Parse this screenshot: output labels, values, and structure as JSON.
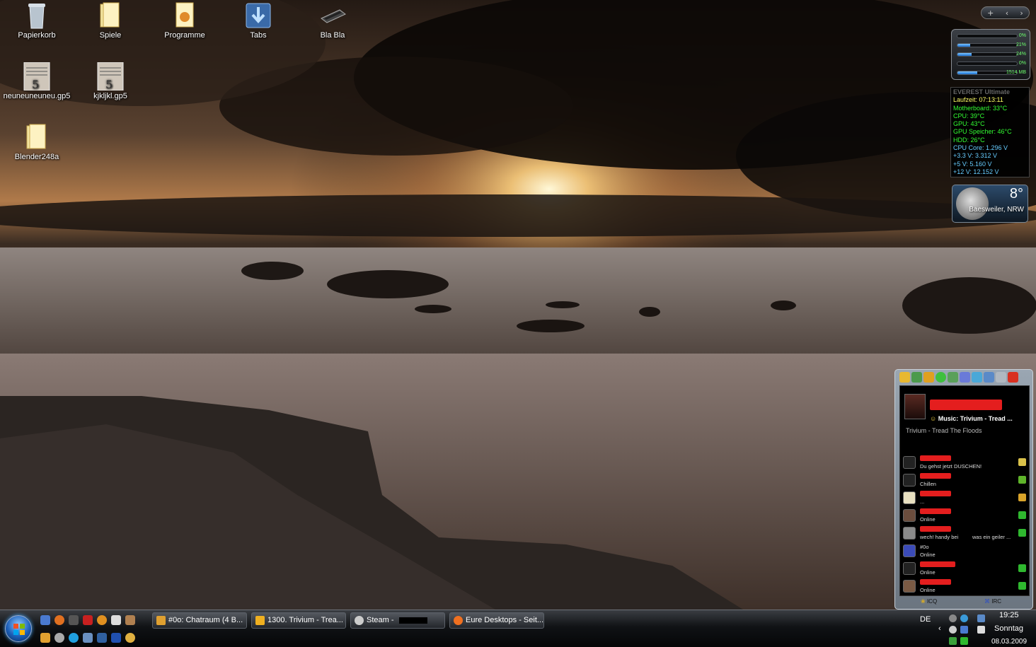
{
  "desktop": {
    "icons": [
      {
        "name": "papierkorb-icon",
        "label": "Papierkorb"
      },
      {
        "name": "spiele-folder-icon",
        "label": "Spiele"
      },
      {
        "name": "programme-folder-icon",
        "label": "Programme"
      },
      {
        "name": "tabs-icon",
        "label": "Tabs"
      },
      {
        "name": "blabla-icon",
        "label": "Bla Bla"
      },
      {
        "name": "neuneuneuneu-gp5-icon",
        "label": "neuneuneuneu.gp5"
      },
      {
        "name": "kjkljkl-gp5-icon",
        "label": "kjkljkl.gp5"
      },
      {
        "name": "blender248a-folder-icon",
        "label": "Blender248a"
      }
    ]
  },
  "gadgets": {
    "controls": {
      "add": "+"
    },
    "meter": {
      "rows": [
        {
          "label": "0%",
          "fraction": 0.0
        },
        {
          "label": "21%",
          "fraction": 0.21
        },
        {
          "label": "24%",
          "fraction": 0.24
        },
        {
          "label": "0%",
          "fraction": 0.0
        },
        {
          "label": "1514 MB",
          "fraction": 0.33
        }
      ]
    },
    "everest": {
      "title": "EVEREST Ultimate",
      "lines": [
        {
          "text": "Laufzeit: 07:13:11",
          "color": "#ffff66"
        },
        {
          "text": "Motherboard: 33°C",
          "color": "#33ff33"
        },
        {
          "text": "CPU: 39°C",
          "color": "#33ff33"
        },
        {
          "text": "GPU: 43°C",
          "color": "#33ff33"
        },
        {
          "text": "GPU Speicher: 46°C",
          "color": "#33ff33"
        },
        {
          "text": "HDD: 26°C",
          "color": "#33ff33"
        },
        {
          "text": "CPU Core: 1.296 V",
          "color": "#66ccff"
        },
        {
          "text": "+3.3 V: 3.312 V",
          "color": "#66ccff"
        },
        {
          "text": "+5 V: 5.160 V",
          "color": "#66ccff"
        },
        {
          "text": "+12 V: 12.152 V",
          "color": "#66ccff"
        }
      ]
    },
    "weather": {
      "temp": "8°",
      "location": "Baesweiler, NRW"
    }
  },
  "icq": {
    "status_message": "Music: Trivium - Tread ...",
    "song": "Trivium - Tread The Floods",
    "contacts": [
      {
        "status": "Du gehst jetzt DUSCHEN!",
        "extra": "",
        "avatar_color": "#222",
        "flag_color": "#d9c14a"
      },
      {
        "status": "Chillen",
        "extra": "",
        "avatar_color": "#222",
        "flag_color": "#5fb42a"
      },
      {
        "status": "...",
        "extra": "",
        "avatar_color": "#e8e0c0",
        "flag_color": "#d9a42a"
      },
      {
        "status": "Online",
        "extra": "",
        "avatar_color": "#6b4d3d",
        "flag_color": "#2fb82f"
      },
      {
        "status": "wech! handy bei",
        "extra": "was ein geiler ...",
        "avatar_color": "#8a8a8a",
        "flag_color": "#2fb82f"
      },
      {
        "status": "#0o",
        "sub": "Online",
        "extra": "",
        "avatar_color": "#3b4bb8",
        "flag_color": ""
      },
      {
        "status": "Online",
        "extra": "",
        "avatar_color": "#222",
        "flag_color": "#2fb82f"
      },
      {
        "status": "Online",
        "extra": "",
        "avatar_color": "#7a5a44",
        "flag_color": "#2fb82f"
      }
    ],
    "tabs": {
      "icq": "ICQ",
      "irc": "IRC"
    }
  },
  "taskbar": {
    "tasks": [
      {
        "label": "#0o: Chatraum (4 B...",
        "icon_color": "#e0a030"
      },
      {
        "label": "1300. Trivium - Trea...",
        "icon_color": "#f0b020"
      },
      {
        "label": "Steam -",
        "icon_color": "#cccccc"
      },
      {
        "label": "Eure Desktops - Seit...",
        "icon_color": "#f07020"
      }
    ],
    "language": "DE",
    "time": "19:25",
    "day": "Sonntag",
    "date": "08.03.2009"
  }
}
